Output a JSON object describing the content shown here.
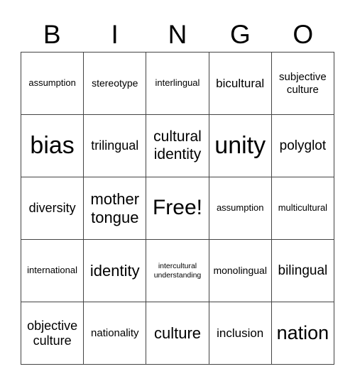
{
  "header": {
    "letters": [
      "B",
      "I",
      "N",
      "G",
      "O"
    ]
  },
  "cells": [
    "assumption",
    "stereotype",
    "interlingual",
    "bicultural",
    "subjective culture",
    "bias",
    "trilingual",
    "cultural identity",
    "unity",
    "polyglot",
    "diversity",
    "mother tongue",
    "Free!",
    "assumption",
    "multicultural",
    "international",
    "identity",
    "intercultural understanding",
    "monolingual",
    "bilingual",
    "objective culture",
    "nationality",
    "culture",
    "inclusion",
    "nation"
  ]
}
